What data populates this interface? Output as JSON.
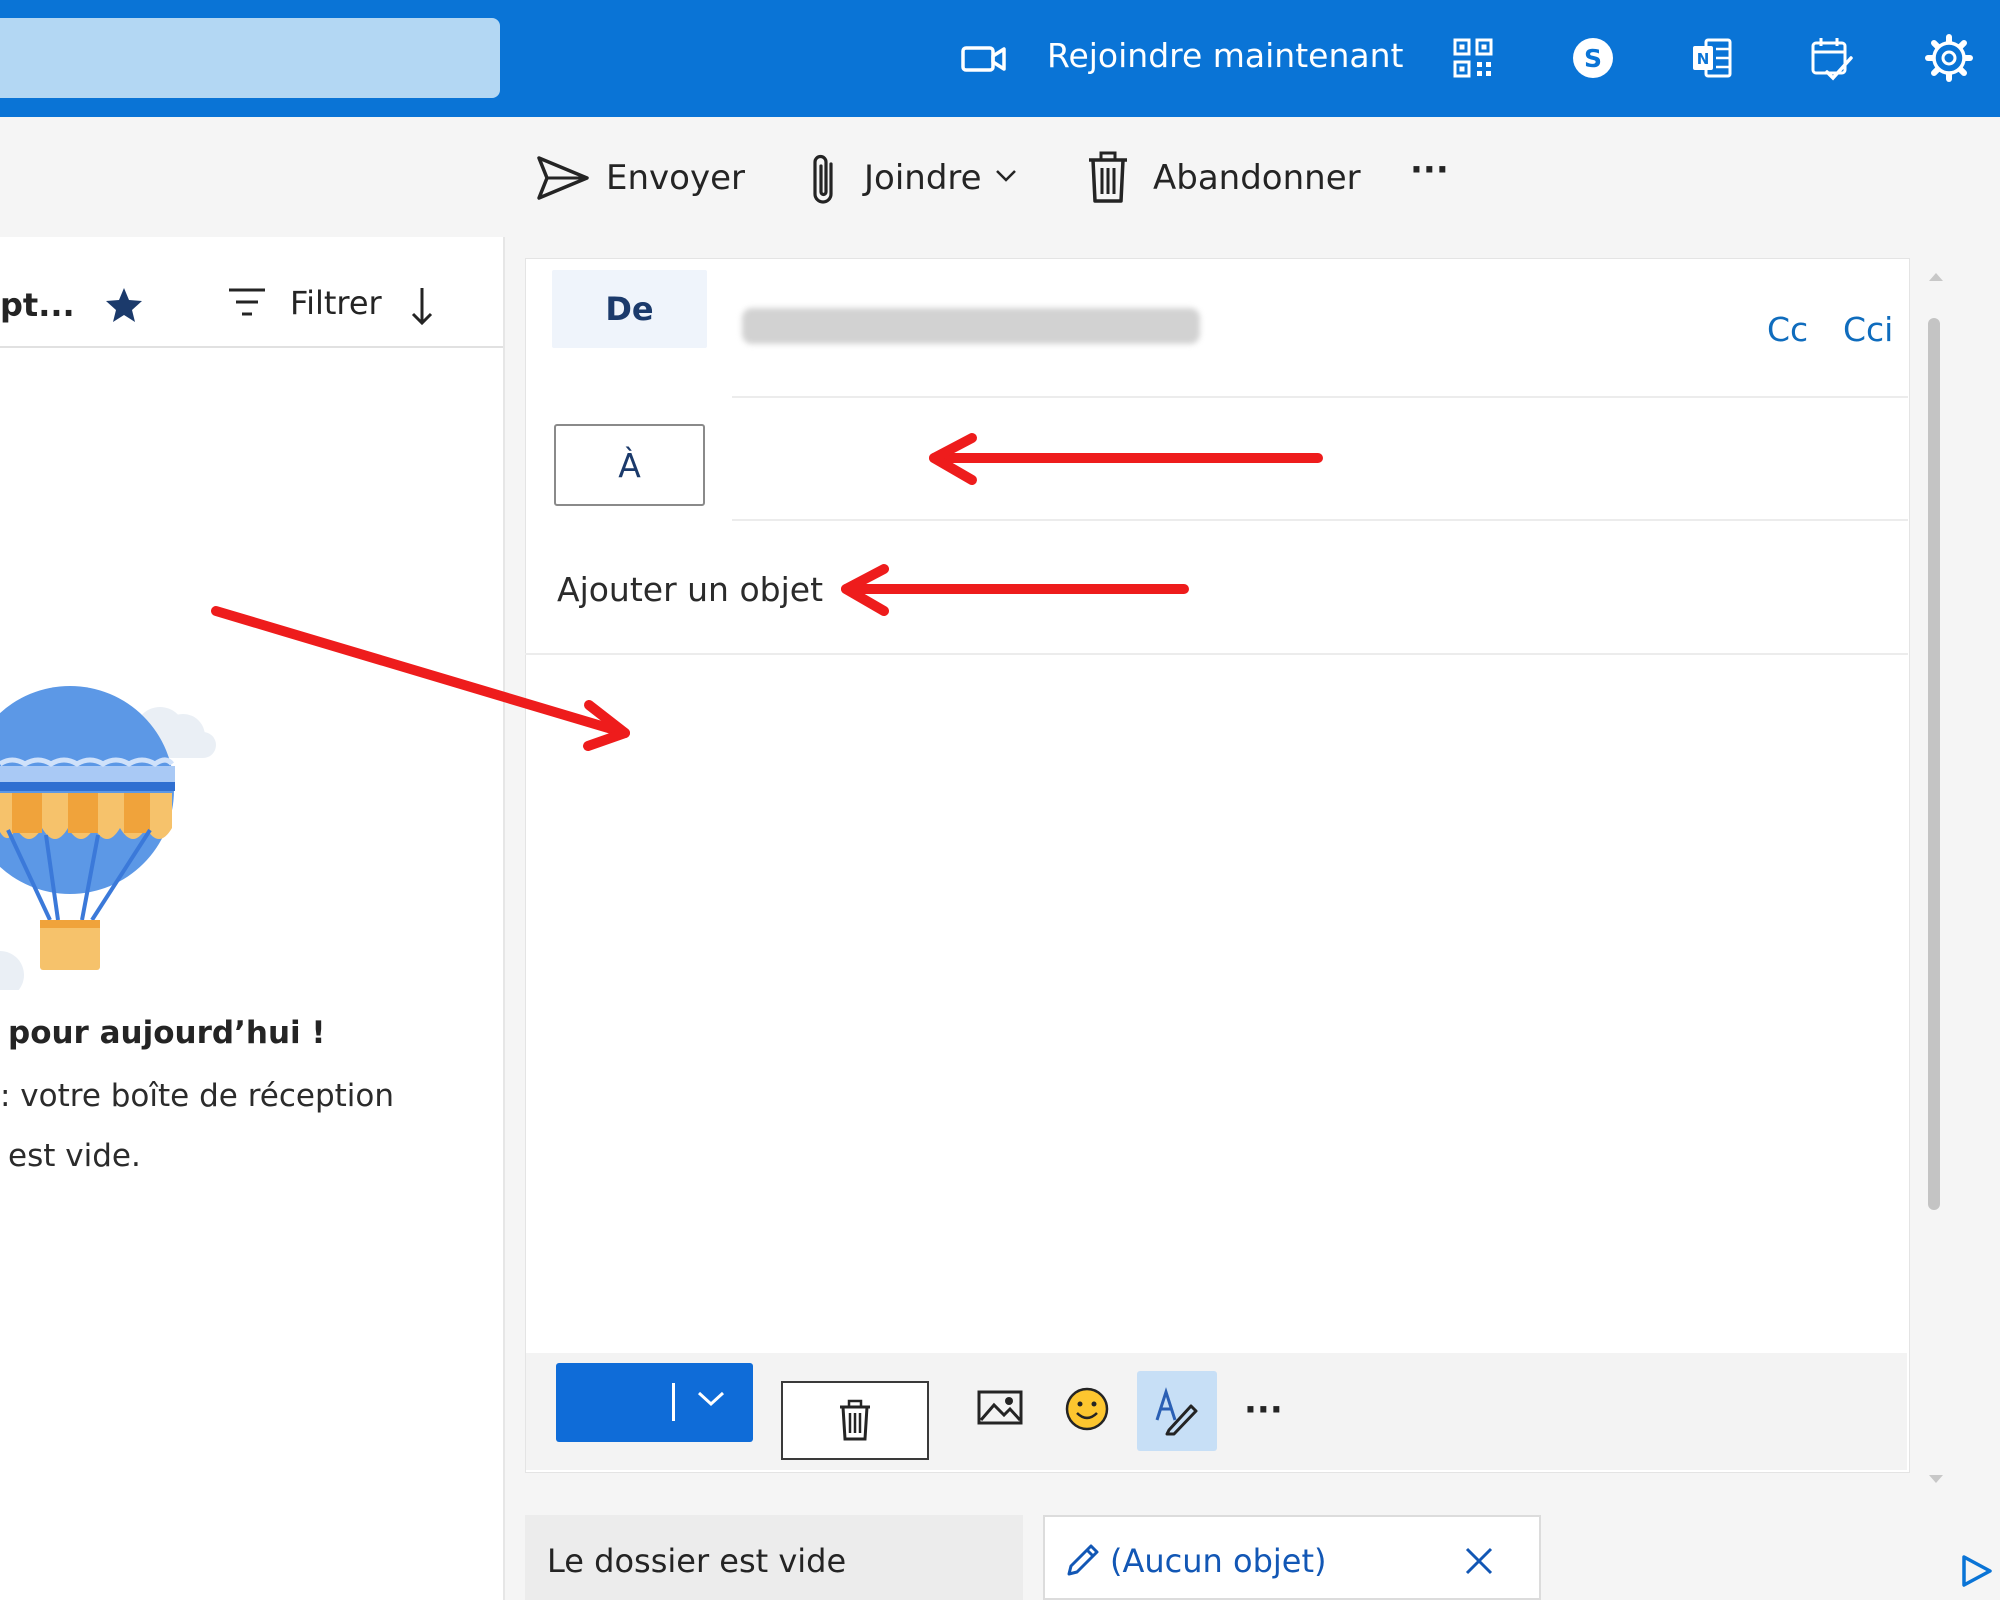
{
  "topbar": {
    "join_label": "Rejoindre maintenant",
    "icons": [
      "video-icon",
      "qr-code-icon",
      "skype-icon",
      "onenote-icon",
      "tasks-icon",
      "gear-icon"
    ],
    "color": "#0a74d6"
  },
  "command_bar": {
    "send_label": "Envoyer",
    "attach_label": "Joindre",
    "discard_label": "Abandonner",
    "more_label": "···"
  },
  "message_list": {
    "view_label": "pt...",
    "filter_label": "Filtrer",
    "empty_title": "pour aujourd’hui !",
    "empty_line1": ": votre boîte de réception",
    "empty_line2": "est vide."
  },
  "compose": {
    "from_label": "De",
    "cc_label": "Cc",
    "bcc_label": "Cci",
    "to_label": "À",
    "subject_placeholder": "Ajouter un objet",
    "footer_more": "···"
  },
  "tabs": {
    "folder_label": "Le dossier est vide",
    "draft_label": "(Aucun objet)"
  },
  "colors": {
    "accent": "#0f6cd8",
    "link": "#0f6cbd",
    "annotation_arrow": "#ee1c1c"
  }
}
